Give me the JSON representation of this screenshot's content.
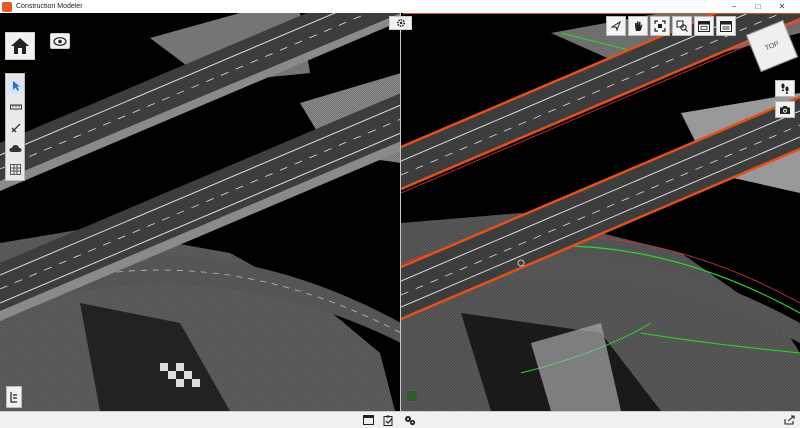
{
  "window": {
    "title": "Construction Modeler",
    "controls": {
      "minimize": "–",
      "maximize": "□",
      "close": "✕"
    }
  },
  "colors": {
    "titlebar": "#ffffff",
    "accent": "#e2511b",
    "selection_green": "#2bd62b",
    "selection_red": "#e0303a",
    "road": "#3a3a3a",
    "lane_marking": "#e6e6e6"
  },
  "left_view": {
    "toolbar": [
      {
        "name": "select-icon"
      },
      {
        "name": "measure-icon"
      },
      {
        "name": "cut-icon"
      },
      {
        "name": "cloud-icon"
      },
      {
        "name": "grid-icon"
      }
    ],
    "home_icon": "home-icon",
    "visibility_icon": "eye-icon",
    "legend_icon": "legend-icon"
  },
  "right_view": {
    "toolbar": [
      {
        "name": "rotate-icon"
      },
      {
        "name": "pan-icon"
      },
      {
        "name": "fit-icon"
      },
      {
        "name": "zoom-window-icon"
      },
      {
        "name": "window-a-icon"
      },
      {
        "name": "window-b-icon"
      }
    ],
    "view_cube_label": "TOP",
    "walk_icon": "footprints-icon",
    "camera_icon": "camera-icon"
  },
  "bottom_bar": {
    "icons": [
      "window-icon",
      "clipboard-icon",
      "settings-pair-icon",
      "export-icon"
    ]
  }
}
